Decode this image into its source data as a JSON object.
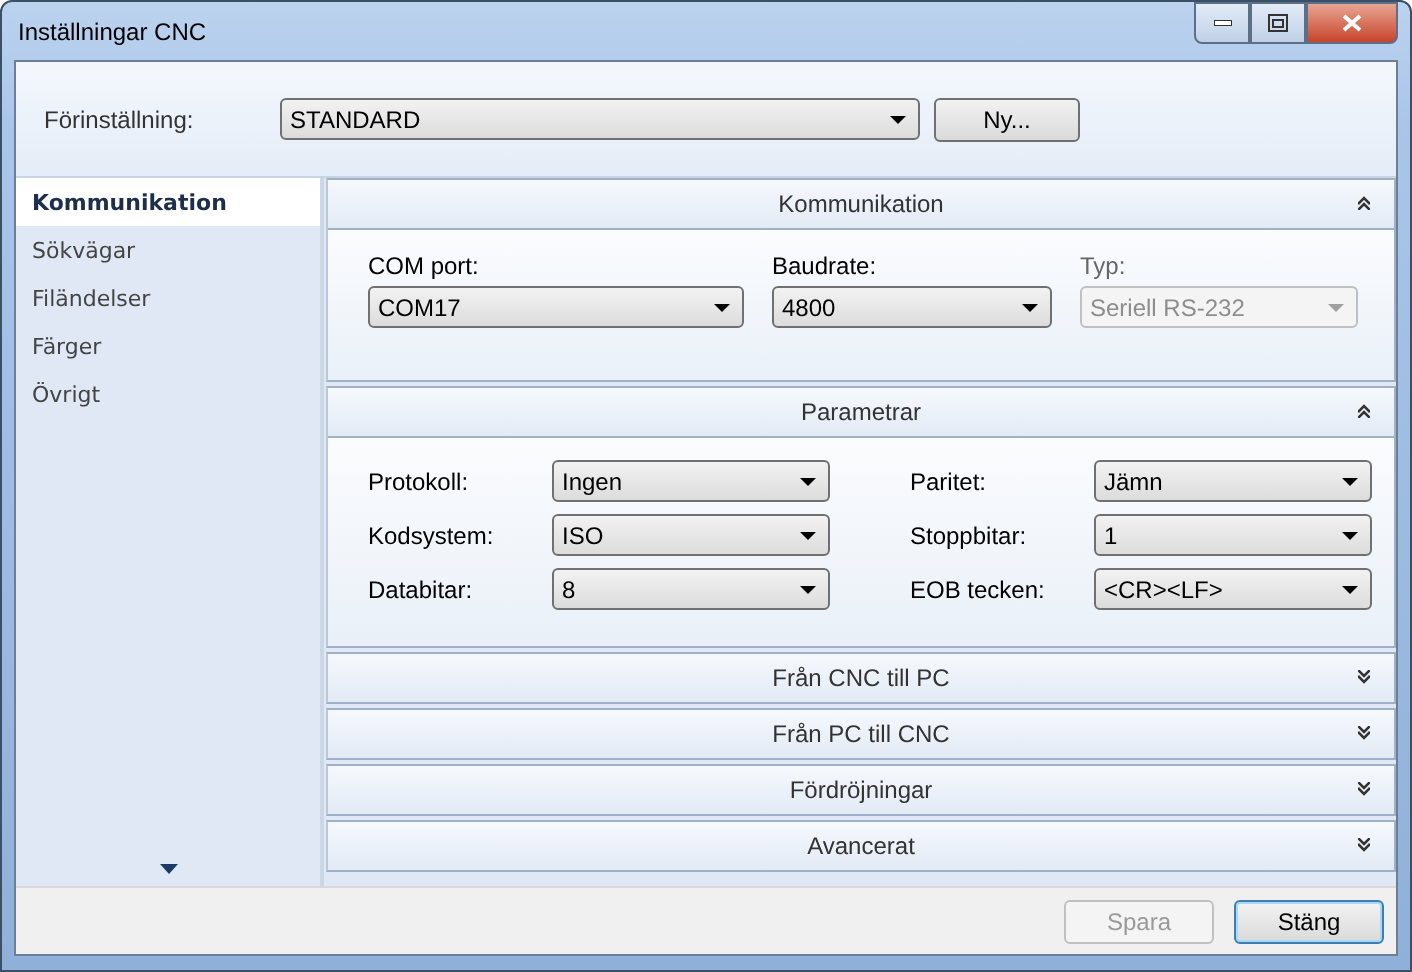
{
  "window": {
    "title": "Inställningar CNC"
  },
  "preset": {
    "label": "Förinställning:",
    "value": "STANDARD",
    "button": "Ny..."
  },
  "sidebar": {
    "items": [
      {
        "label": "Kommunikation",
        "selected": true
      },
      {
        "label": "Sökvägar",
        "selected": false
      },
      {
        "label": "Filändelser",
        "selected": false
      },
      {
        "label": "Färger",
        "selected": false
      },
      {
        "label": "Övrigt",
        "selected": false
      }
    ]
  },
  "sections": [
    {
      "title": "Kommunikation",
      "expanded": true,
      "kind": "stacked",
      "fields": [
        {
          "label": "COM port:",
          "value": "COM17",
          "disabled": false
        },
        {
          "label": "Baudrate:",
          "value": "4800",
          "disabled": false
        },
        {
          "label": "Typ:",
          "value": "Seriell RS-232",
          "disabled": true
        }
      ]
    },
    {
      "title": "Parametrar",
      "expanded": true,
      "kind": "inline",
      "fields": [
        {
          "label": "Protokoll:",
          "value": "Ingen",
          "disabled": false
        },
        {
          "label": "Paritet:",
          "value": "Jämn",
          "disabled": false
        },
        {
          "label": "Kodsystem:",
          "value": "ISO",
          "disabled": false
        },
        {
          "label": "Stoppbitar:",
          "value": "1",
          "disabled": false
        },
        {
          "label": "Databitar:",
          "value": "8",
          "disabled": false
        },
        {
          "label": "EOB tecken:",
          "value": "<CR><LF>",
          "disabled": false
        }
      ]
    },
    {
      "title": "Från CNC till PC",
      "expanded": false
    },
    {
      "title": "Från PC till CNC",
      "expanded": false
    },
    {
      "title": "Fördröjningar",
      "expanded": false
    },
    {
      "title": "Avancerat",
      "expanded": false
    }
  ],
  "buttons": [
    {
      "label": "Spara",
      "disabled": true
    },
    {
      "label": "Stäng",
      "disabled": false
    }
  ]
}
